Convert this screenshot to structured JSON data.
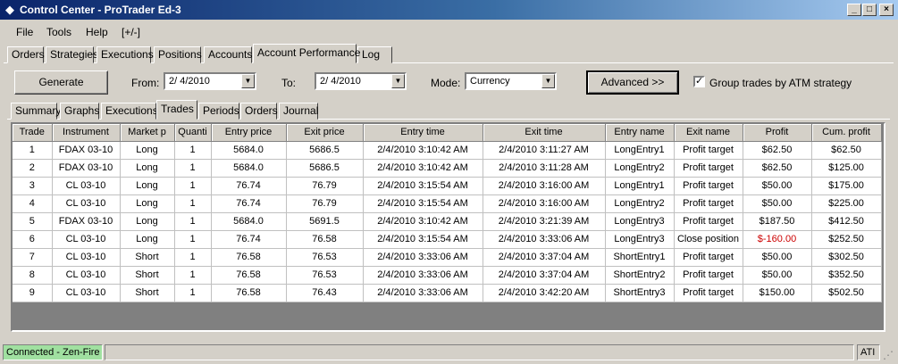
{
  "window": {
    "title": "Control Center - ProTrader Ed-3",
    "minimize": "_",
    "maximize": "□",
    "close": "×"
  },
  "menu": [
    "File",
    "Tools",
    "Help",
    "[+/-]"
  ],
  "main_tabs": [
    "Orders",
    "Strategies",
    "Executions",
    "Positions",
    "Accounts",
    "Account Performance",
    "Log"
  ],
  "toolbar": {
    "generate_label": "Generate",
    "from_label": "From:",
    "from_value": "2/  4/2010",
    "to_label": "To:",
    "to_value": "2/  4/2010",
    "mode_label": "Mode:",
    "mode_value": "Currency",
    "advanced_label": "Advanced >>",
    "group_label": "Group trades by ATM strategy",
    "group_checked": "✓"
  },
  "sub_tabs": [
    "Summary",
    "Graphs",
    "Executions",
    "Trades",
    "Periods",
    "Orders",
    "Journal"
  ],
  "table": {
    "columns": [
      "Trade",
      "Instrument",
      "Market p",
      "Quanti",
      "Entry price",
      "Exit price",
      "Entry time",
      "Exit time",
      "Entry name",
      "Exit name",
      "Profit",
      "Cum. profit"
    ],
    "rows": [
      [
        "1",
        "FDAX 03-10",
        "Long",
        "1",
        "5684.0",
        "5686.5",
        "2/4/2010 3:10:42 AM",
        "2/4/2010 3:11:27 AM",
        "LongEntry1",
        "Profit target",
        "$62.50",
        "$62.50"
      ],
      [
        "2",
        "FDAX 03-10",
        "Long",
        "1",
        "5684.0",
        "5686.5",
        "2/4/2010 3:10:42 AM",
        "2/4/2010 3:11:28 AM",
        "LongEntry2",
        "Profit target",
        "$62.50",
        "$125.00"
      ],
      [
        "3",
        "CL 03-10",
        "Long",
        "1",
        "76.74",
        "76.79",
        "2/4/2010 3:15:54 AM",
        "2/4/2010 3:16:00 AM",
        "LongEntry1",
        "Profit target",
        "$50.00",
        "$175.00"
      ],
      [
        "4",
        "CL 03-10",
        "Long",
        "1",
        "76.74",
        "76.79",
        "2/4/2010 3:15:54 AM",
        "2/4/2010 3:16:00 AM",
        "LongEntry2",
        "Profit target",
        "$50.00",
        "$225.00"
      ],
      [
        "5",
        "FDAX 03-10",
        "Long",
        "1",
        "5684.0",
        "5691.5",
        "2/4/2010 3:10:42 AM",
        "2/4/2010 3:21:39 AM",
        "LongEntry3",
        "Profit target",
        "$187.50",
        "$412.50"
      ],
      [
        "6",
        "CL 03-10",
        "Long",
        "1",
        "76.74",
        "76.58",
        "2/4/2010 3:15:54 AM",
        "2/4/2010 3:33:06 AM",
        "LongEntry3",
        "Close position",
        "$-160.00",
        "$252.50"
      ],
      [
        "7",
        "CL 03-10",
        "Short",
        "1",
        "76.58",
        "76.53",
        "2/4/2010 3:33:06 AM",
        "2/4/2010 3:37:04 AM",
        "ShortEntry1",
        "Profit target",
        "$50.00",
        "$302.50"
      ],
      [
        "8",
        "CL 03-10",
        "Short",
        "1",
        "76.58",
        "76.53",
        "2/4/2010 3:33:06 AM",
        "2/4/2010 3:37:04 AM",
        "ShortEntry2",
        "Profit target",
        "$50.00",
        "$352.50"
      ],
      [
        "9",
        "CL 03-10",
        "Short",
        "1",
        "76.58",
        "76.43",
        "2/4/2010 3:33:06 AM",
        "2/4/2010 3:42:20 AM",
        "ShortEntry3",
        "Profit target",
        "$150.00",
        "$502.50"
      ]
    ]
  },
  "status": {
    "connection": "Connected - Zen-Fire",
    "connection_color": "#a0e0a0",
    "right": "ATI"
  }
}
